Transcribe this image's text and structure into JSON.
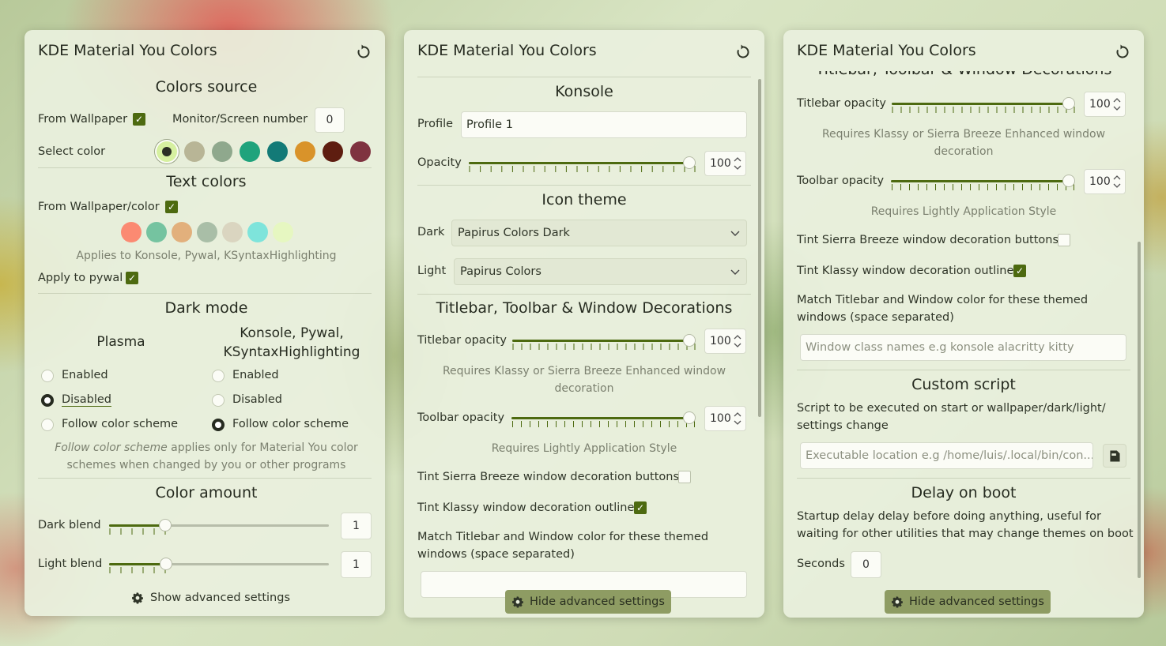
{
  "app_title": "KDE Material You Colors",
  "panel1": {
    "colors_source": {
      "header": "Colors source",
      "from_wallpaper_label": "From Wallpaper",
      "from_wallpaper_checked": true,
      "monitor_label": "Monitor/Screen number",
      "monitor_value": "0",
      "select_color_label": "Select color",
      "swatches": [
        "#d6f0a0",
        "#b8b596",
        "#8fa88d",
        "#1fa37c",
        "#137a77",
        "#d9932a",
        "#5e1d10",
        "#7f3340"
      ],
      "selected_swatch": 0
    },
    "text_colors": {
      "header": "Text colors",
      "from_label": "From Wallpaper/color",
      "from_checked": true,
      "swatches": [
        "#fb8a72",
        "#75c3a0",
        "#e2b07c",
        "#a9bea7",
        "#dad5c0",
        "#7ee4db",
        "#e6f7c1"
      ],
      "note": "Applies to Konsole, Pywal, KSyntaxHighlighting",
      "apply_pywal_label": "Apply to pywal",
      "apply_pywal_checked": true
    },
    "dark_mode": {
      "header": "Dark mode",
      "col1_title": "Plasma",
      "col2_title_line1": "Konsole, Pywal,",
      "col2_title_line2": "KSyntaxHighlighting",
      "opt_enabled": "Enabled",
      "opt_disabled": "Disabled",
      "opt_follow": "Follow color scheme",
      "plasma_selected": "Disabled",
      "konsole_selected": "Follow color scheme",
      "note_em": "Follow color scheme",
      "note_rest1": " applies only for Material You color",
      "note_line2": "schemes when changed by you or other programs"
    },
    "color_amount": {
      "header": "Color amount",
      "dark_label": "Dark blend",
      "dark_value": "1",
      "light_label": "Light blend",
      "light_value": "1"
    },
    "show_advanced": "Show advanced settings"
  },
  "panel2": {
    "konsole": {
      "header": "Konsole",
      "profile_label": "Profile",
      "profile_value": "Profile 1",
      "opacity_label": "Opacity",
      "opacity_value": "100"
    },
    "icon_theme": {
      "header": "Icon theme",
      "dark_label": "Dark",
      "dark_value": "Papirus Colors Dark",
      "light_label": "Light",
      "light_value": "Papirus Colors"
    },
    "decorations": {
      "header": "Titlebar, Toolbar & Window Decorations",
      "titlebar_label": "Titlebar opacity",
      "titlebar_value": "100",
      "titlebar_note_line1": "Requires Klassy or Sierra Breeze Enhanced window",
      "titlebar_note_line2": "decoration",
      "toolbar_label": "Toolbar opacity",
      "toolbar_value": "100",
      "toolbar_note": "Requires Lightly Application Style",
      "tint_sierra_label": "Tint Sierra Breeze window decoration buttons",
      "tint_sierra_checked": false,
      "tint_klassy_label": "Tint Klassy window decoration outline",
      "tint_klassy_checked": true,
      "match_line1": "Match Titlebar and Window color for these themed",
      "match_line2": "windows (space separated)"
    },
    "hide_advanced": "Hide advanced settings"
  },
  "panel3": {
    "cut_header": "Titlebar, Toolbar & Window Decorations",
    "titlebar_label": "Titlebar opacity",
    "titlebar_value": "100",
    "titlebar_note_line1": "Requires Klassy or Sierra Breeze Enhanced window",
    "titlebar_note_line2": "decoration",
    "toolbar_label": "Toolbar opacity",
    "toolbar_value": "100",
    "toolbar_note": "Requires Lightly Application Style",
    "tint_sierra_label": "Tint Sierra Breeze window decoration buttons",
    "tint_sierra_checked": false,
    "tint_klassy_label": "Tint Klassy window decoration outline",
    "tint_klassy_checked": true,
    "match_line1": "Match Titlebar and Window color for these themed",
    "match_line2": "windows (space separated)",
    "window_class_placeholder": "Window class names e.g konsole alacritty kitty",
    "custom_script": {
      "header": "Custom script",
      "desc_line1": "Script to be executed on start or wallpaper/dark/light/",
      "desc_line2": "settings change",
      "placeholder": "Executable location e.g /home/luis/.local/bin/con..."
    },
    "delay": {
      "header": "Delay on boot",
      "desc_line1": "Startup delay delay before doing anything, useful for",
      "desc_line2": "waiting for other utilities that may change themes on boot",
      "seconds_label": "Seconds",
      "seconds_value": "0"
    },
    "hide_advanced": "Hide advanced settings"
  },
  "colors": {
    "accent": "#4d6a10",
    "panel_bg": "#eaf0de",
    "button_bg": "#8e9c63"
  }
}
